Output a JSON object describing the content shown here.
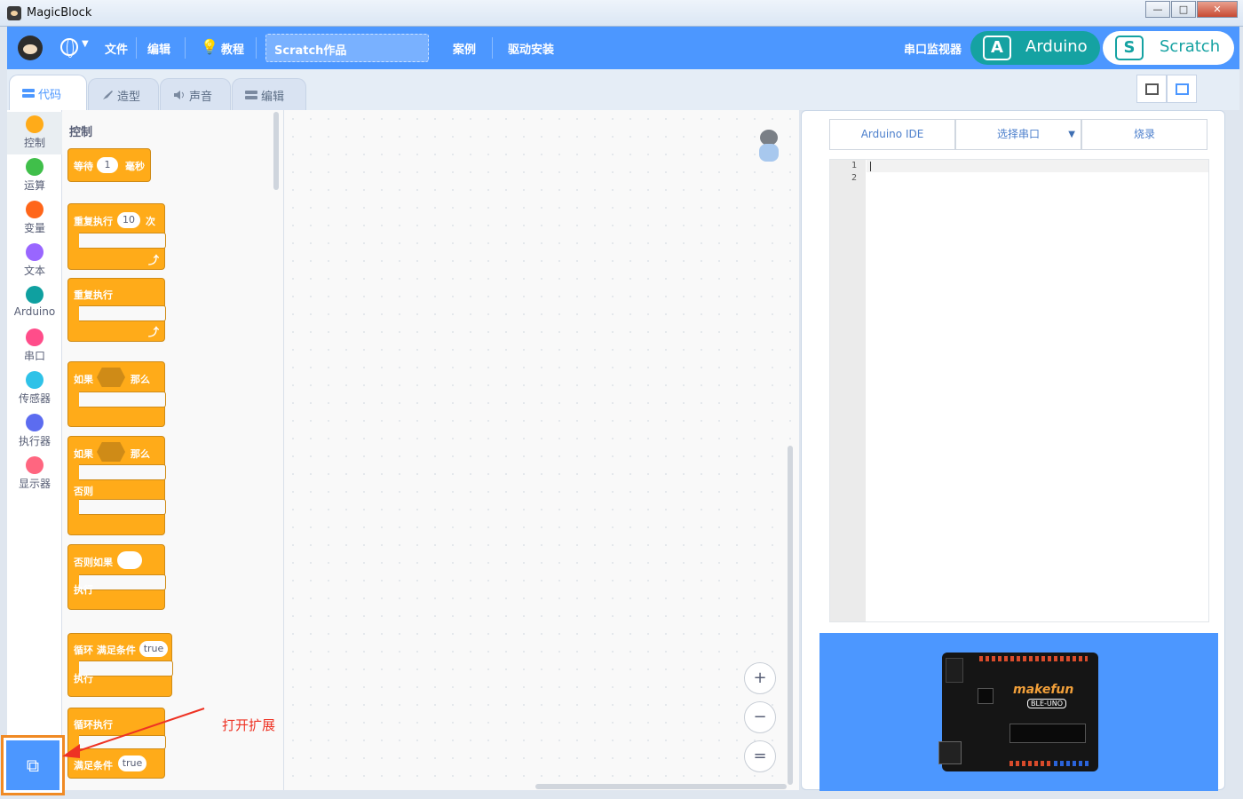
{
  "window": {
    "title": "MagicBlock",
    "minimize": "—",
    "maximize": "□",
    "close": "✕"
  },
  "menubar": {
    "file": "文件",
    "edit": "编辑",
    "tutorial": "教程",
    "project_name": "Scratch作品",
    "examples": "案例",
    "driver_install": "驱动安装",
    "serial_monitor": "串口监视器",
    "mode_arduino": "Arduino",
    "mode_scratch": "Scratch",
    "mode_arduino_icon": "A",
    "mode_scratch_icon": "S"
  },
  "tabs": [
    {
      "label": "代码"
    },
    {
      "label": "造型"
    },
    {
      "label": "声音"
    },
    {
      "label": "编辑"
    }
  ],
  "categories": [
    {
      "label": "控制",
      "color": "#ffab19"
    },
    {
      "label": "运算",
      "color": "#40bf4a"
    },
    {
      "label": "变量",
      "color": "#ff661a"
    },
    {
      "label": "文本",
      "color": "#9966ff"
    },
    {
      "label": "Arduino",
      "color": "#0fa0a0"
    },
    {
      "label": "串口",
      "color": "#ff4d8a"
    },
    {
      "label": "传感器",
      "color": "#2fc2e8"
    },
    {
      "label": "执行器",
      "color": "#5c6cf0"
    },
    {
      "label": "显示器",
      "color": "#ff6680"
    }
  ],
  "palette": {
    "title": "控制",
    "wait": {
      "label": "等待",
      "value": "1",
      "unit": "毫秒"
    },
    "repeat_n": {
      "label": "重复执行",
      "value": "10",
      "unit": "次"
    },
    "forever": {
      "label": "重复执行"
    },
    "if_then": {
      "if": "如果",
      "then": "那么"
    },
    "if_else": {
      "if": "如果",
      "then": "那么",
      "else": "否则"
    },
    "else_if": {
      "label": "否则如果",
      "do": "执行"
    },
    "while": {
      "label": "循环 满足条件",
      "value": "true",
      "do": "执行"
    },
    "do_while": {
      "label": "循环执行",
      "cond": "满足条件",
      "value": "true"
    }
  },
  "annotation": {
    "text": "打开扩展"
  },
  "right_panel": {
    "ide_button": "Arduino IDE",
    "port_select": "选择串口",
    "upload_button": "烧录",
    "line_numbers": [
      "1",
      "2"
    ],
    "board_brand": "makefun",
    "board_model": "BLE-UNO"
  },
  "zoom": {
    "in": "+",
    "out": "−",
    "reset": "="
  },
  "colors": {
    "accent": "#4c97ff",
    "control": "#ffab19",
    "arduino_mode": "#15a2a2",
    "annotation": "#ee3324"
  }
}
